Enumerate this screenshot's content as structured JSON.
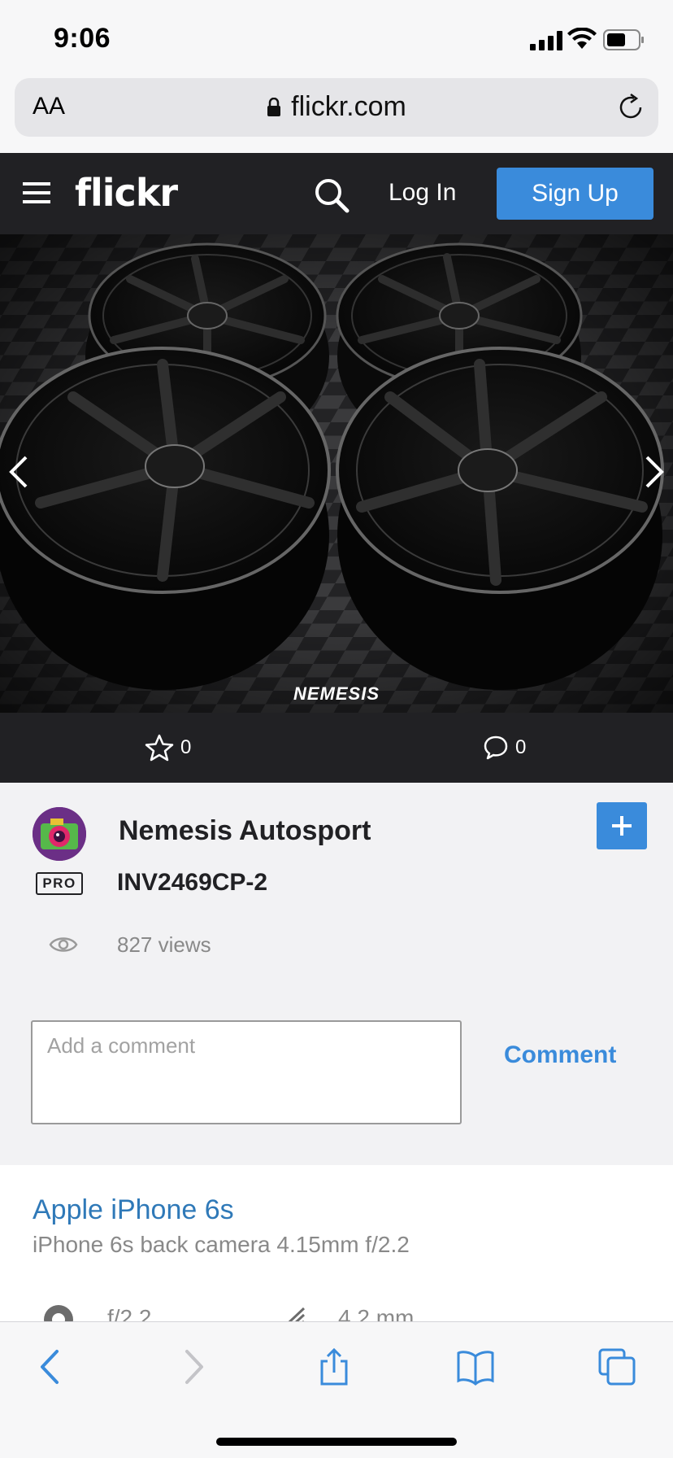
{
  "status_bar": {
    "time": "9:06"
  },
  "address_bar": {
    "text_size_label": "AA",
    "url": "flickr.com"
  },
  "header": {
    "logo": "flickr",
    "login_label": "Log In",
    "signup_label": "Sign Up"
  },
  "photo": {
    "watermark": "NEMESIS"
  },
  "actions": {
    "faves_count": "0",
    "comments_count": "0"
  },
  "info": {
    "owner_name": "Nemesis Autosport",
    "pro_badge": "PRO",
    "title": "INV2469CP-2",
    "views": "827 views",
    "comment_placeholder": "Add a comment",
    "comment_button": "Comment"
  },
  "camera": {
    "name": "Apple iPhone 6s",
    "lens": "iPhone 6s back camera 4.15mm f/2.2",
    "aperture": "f/2.2",
    "focal_length": "4.2 mm"
  },
  "colors": {
    "accent": "#3a8bdb",
    "dark": "#212124",
    "link": "#2f79b8"
  }
}
